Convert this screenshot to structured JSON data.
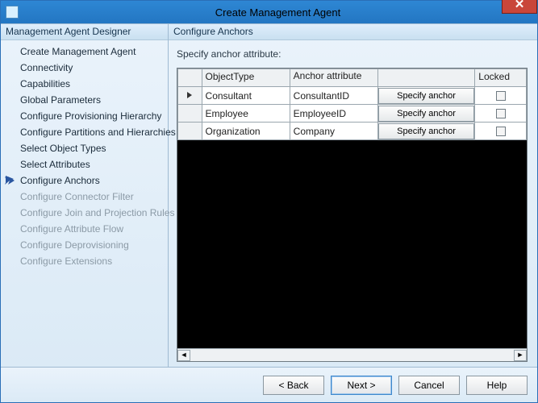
{
  "window": {
    "title": "Create Management Agent"
  },
  "sidebar": {
    "header": "Management Agent Designer",
    "items": [
      {
        "label": "Create Management Agent",
        "state": "done"
      },
      {
        "label": "Connectivity",
        "state": "done"
      },
      {
        "label": "Capabilities",
        "state": "done"
      },
      {
        "label": "Global Parameters",
        "state": "done"
      },
      {
        "label": "Configure Provisioning Hierarchy",
        "state": "done"
      },
      {
        "label": "Configure Partitions and Hierarchies",
        "state": "done"
      },
      {
        "label": "Select Object Types",
        "state": "done"
      },
      {
        "label": "Select Attributes",
        "state": "done"
      },
      {
        "label": "Configure Anchors",
        "state": "active"
      },
      {
        "label": "Configure Connector Filter",
        "state": "todo"
      },
      {
        "label": "Configure Join and Projection Rules",
        "state": "todo"
      },
      {
        "label": "Configure Attribute Flow",
        "state": "todo"
      },
      {
        "label": "Configure Deprovisioning",
        "state": "todo"
      },
      {
        "label": "Configure Extensions",
        "state": "todo"
      }
    ]
  },
  "main": {
    "header": "Configure Anchors",
    "instruction": "Specify anchor attribute:",
    "columns": {
      "objectType": "ObjectType",
      "anchorAttr": "Anchor attribute",
      "action": "",
      "locked": "Locked"
    },
    "action_button_label": "Specify anchor",
    "rows": [
      {
        "objectType": "Consultant",
        "anchorAttr": "ConsultantID",
        "locked": false,
        "selected": true,
        "current": true
      },
      {
        "objectType": "Employee",
        "anchorAttr": "EmployeeID",
        "locked": false,
        "selected": false,
        "current": false
      },
      {
        "objectType": "Organization",
        "anchorAttr": "Company",
        "locked": false,
        "selected": false,
        "current": false
      }
    ]
  },
  "footer": {
    "back": "<  Back",
    "next": "Next  >",
    "cancel": "Cancel",
    "help": "Help"
  }
}
